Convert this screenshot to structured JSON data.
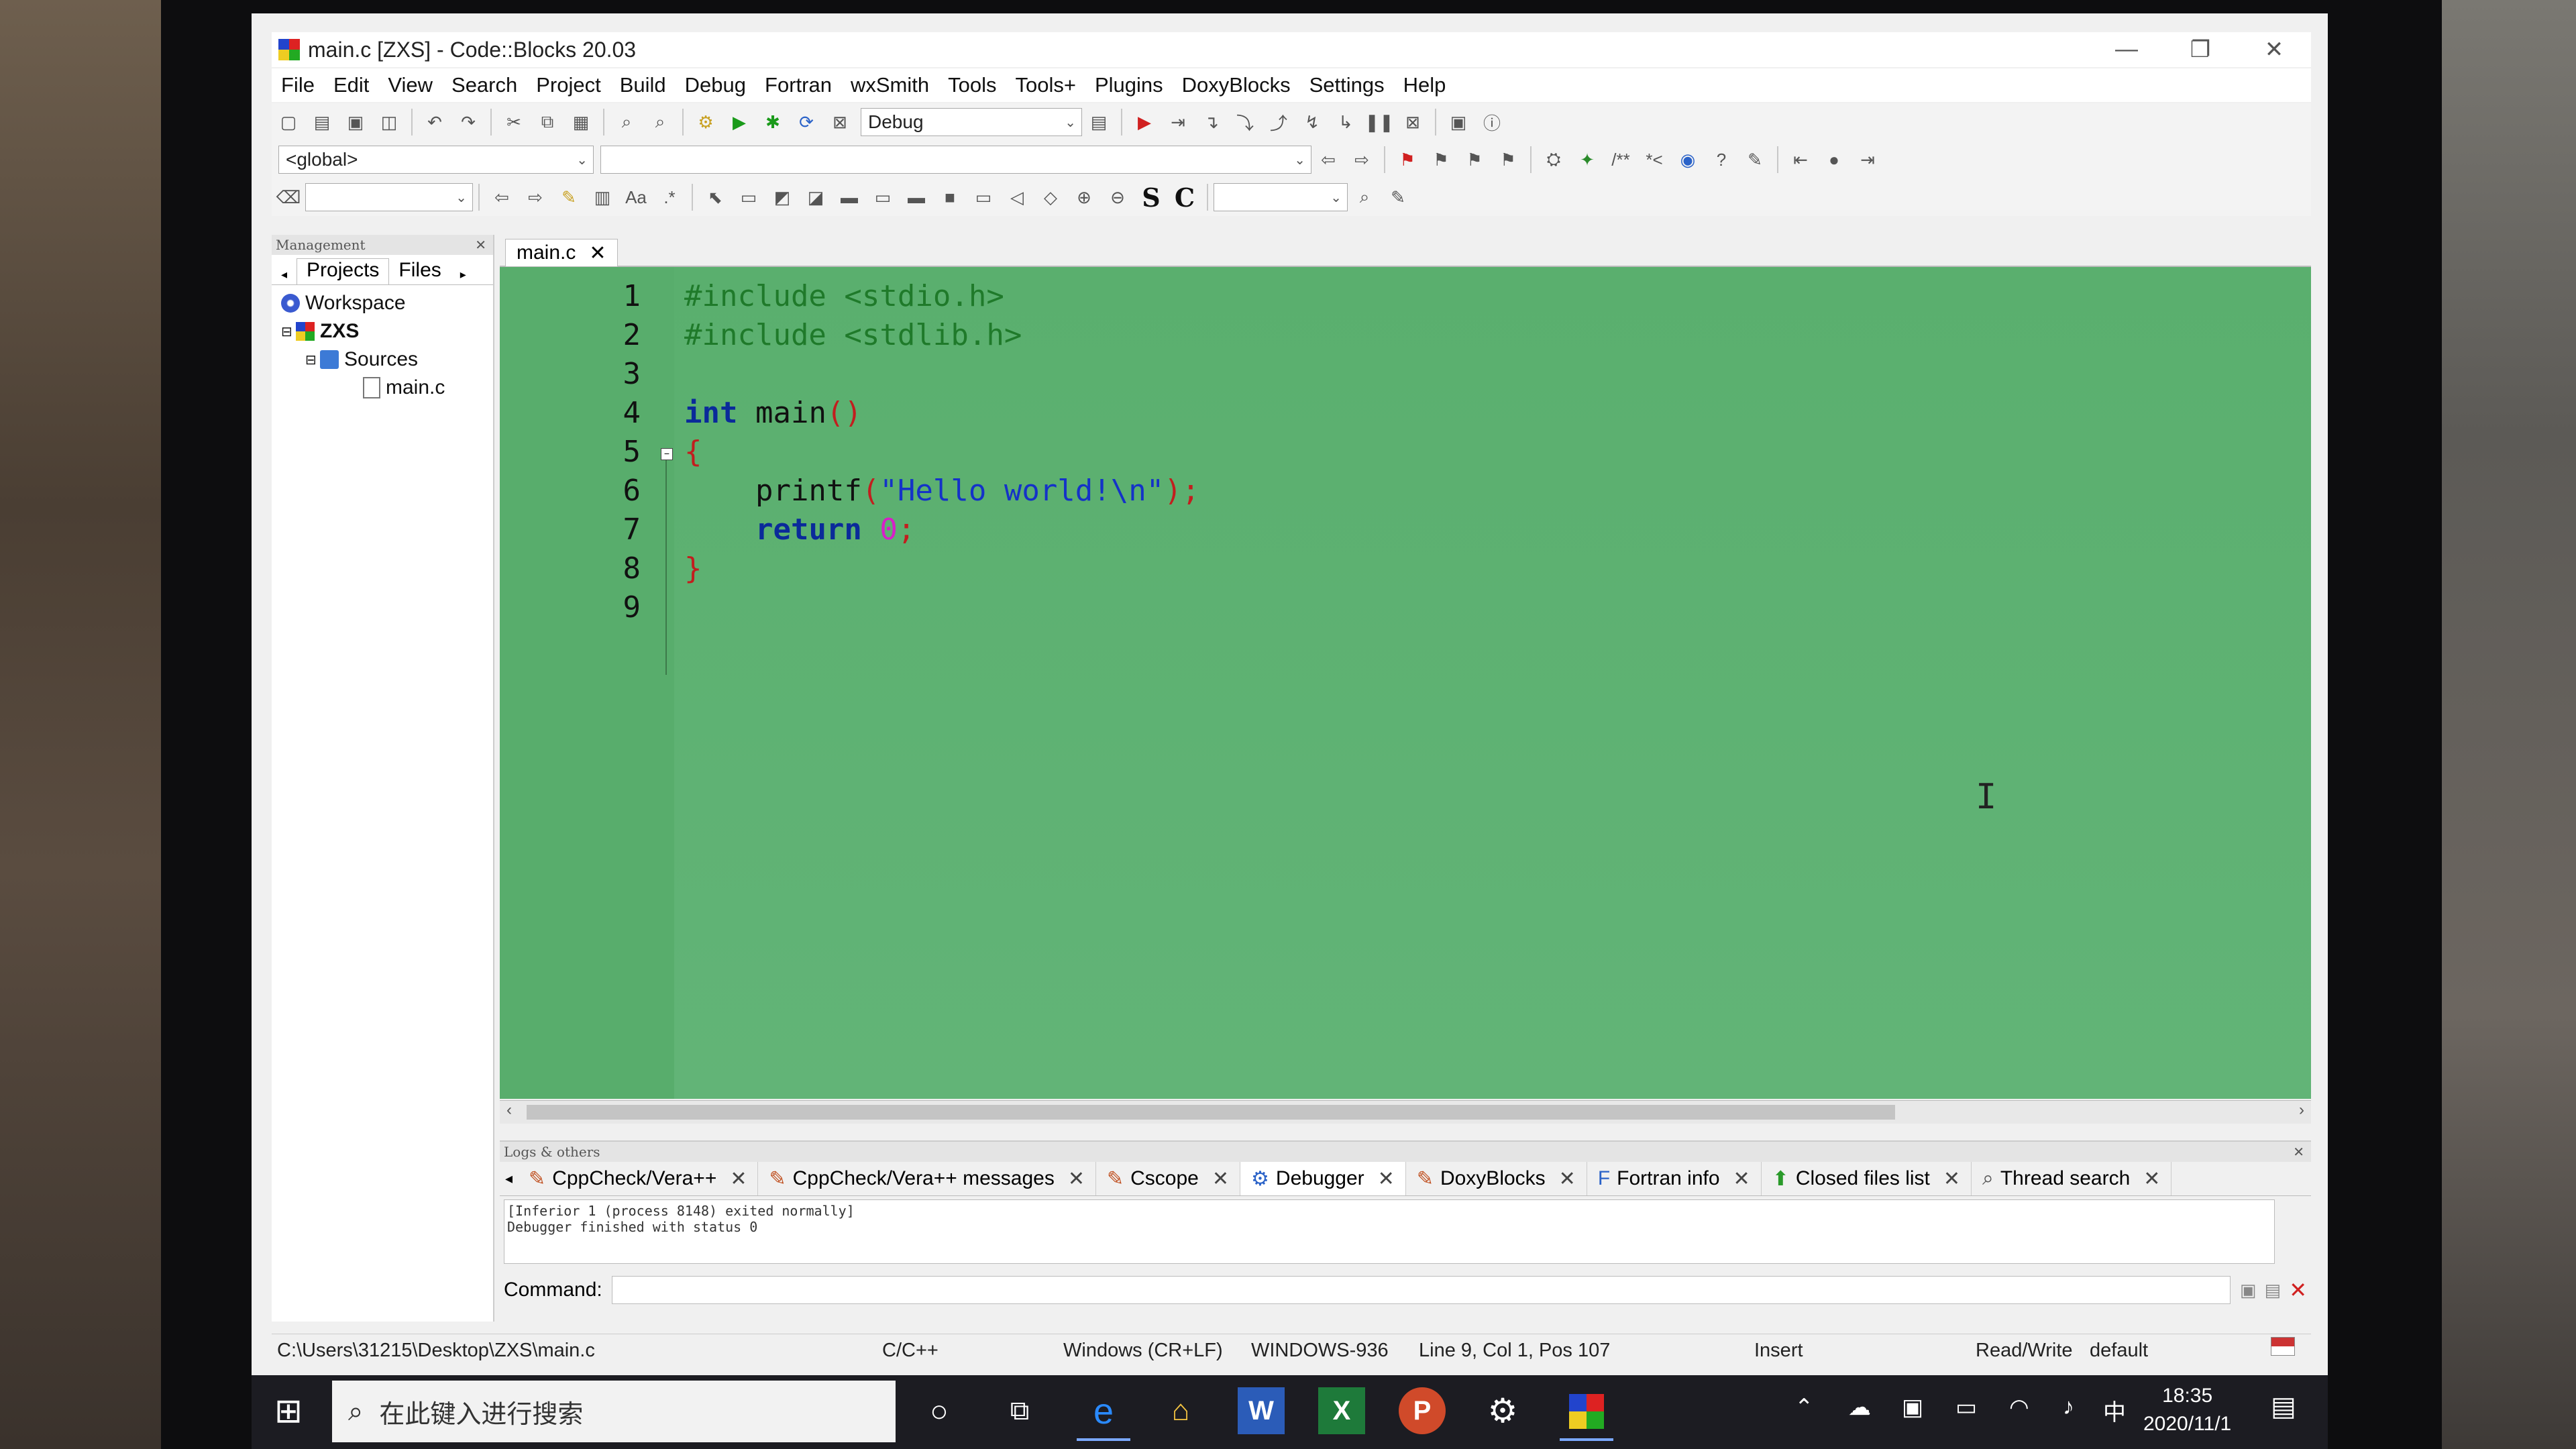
{
  "window": {
    "title": "main.c [ZXS] - Code::Blocks 20.03",
    "controls": [
      "—",
      "❐",
      "✕"
    ]
  },
  "menu": [
    "File",
    "Edit",
    "View",
    "Search",
    "Project",
    "Build",
    "Debug",
    "Fortran",
    "wxSmith",
    "Tools",
    "Tools+",
    "Plugins",
    "DoxyBlocks",
    "Settings",
    "Help"
  ],
  "toolbar": {
    "build_target": "Debug",
    "scope": "<global>",
    "bold_s": "S",
    "bold_c": "C"
  },
  "management": {
    "header": "Management",
    "tabs": [
      "Projects",
      "Files"
    ],
    "tree": [
      {
        "label": "Workspace",
        "icon": "workspace-icon"
      },
      {
        "label": "ZXS",
        "icon": "project-icon"
      },
      {
        "label": "Sources",
        "icon": "folder-icon"
      },
      {
        "label": "main.c",
        "icon": "file-icon"
      }
    ]
  },
  "editor": {
    "tab_label": "main.c",
    "line_numbers": [
      "1",
      "2",
      "3",
      "4",
      "5",
      "6",
      "7",
      "8",
      "9"
    ],
    "lines": [
      "#include <stdio.h>",
      "#include <stdlib.h>",
      "",
      "int main()",
      "{",
      "    printf(\"Hello world!\\n\");",
      "    return 0;",
      "}",
      ""
    ]
  },
  "logs": {
    "header": "Logs & others",
    "tabs": [
      {
        "label": "CppCheck/Vera++",
        "icon": "pencil-icon"
      },
      {
        "label": "CppCheck/Vera++ messages",
        "icon": "pencil-icon"
      },
      {
        "label": "Cscope",
        "icon": "pencil-icon"
      },
      {
        "label": "Debugger",
        "icon": "gear-icon"
      },
      {
        "label": "DoxyBlocks",
        "icon": "pencil-icon"
      },
      {
        "label": "Fortran info",
        "icon": "fortran-icon"
      },
      {
        "label": "Closed files list",
        "icon": "closed-files-icon"
      },
      {
        "label": "Thread search",
        "icon": "search-icon"
      }
    ],
    "output": [
      "[Inferior 1 (process 8148) exited normally]",
      "Debugger finished with status 0"
    ],
    "command_label": "Command:"
  },
  "status": {
    "path": "C:\\Users\\31215\\Desktop\\ZXS\\main.c",
    "language": "C/C++",
    "eol": "Windows (CR+LF)",
    "encoding": "WINDOWS-936",
    "position": "Line 9, Col 1, Pos 107",
    "mode": "Insert",
    "access": "Read/Write",
    "profile": "default"
  },
  "taskbar": {
    "search_placeholder": "在此键入进行搜索",
    "time": "18:35",
    "date": "2020/11/1",
    "ime": "中"
  }
}
